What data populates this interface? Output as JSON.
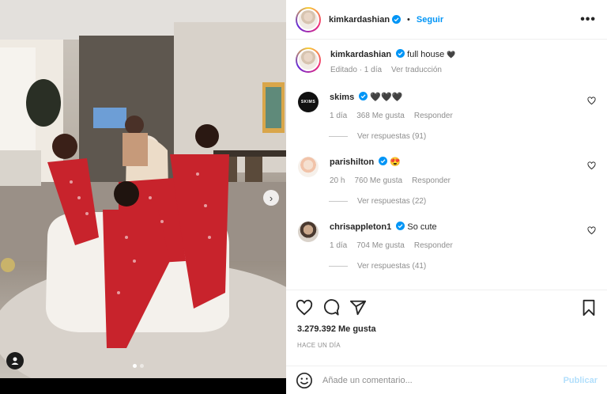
{
  "post": {
    "author": "kimkardashian",
    "follow_label": "Seguir",
    "separator": "•",
    "more_label": "•••",
    "caption_text": "full house",
    "caption_emoji": "🖤",
    "edited_label": "Editado · 1 día",
    "translate_label": "Ver traducción",
    "likes": "3.279.392 Me gusta",
    "timestamp": "HACE UN DÍA"
  },
  "comments": [
    {
      "user": "skims",
      "text": "🖤🖤🖤",
      "age": "1 día",
      "likes": "368 Me gusta",
      "reply_label": "Responder",
      "replies": "Ver respuestas (91)"
    },
    {
      "user": "parishilton",
      "text": "😍",
      "age": "20 h",
      "likes": "760 Me gusta",
      "reply_label": "Responder",
      "replies": "Ver respuestas (22)"
    },
    {
      "user": "chrisappleton1",
      "text": "So cute",
      "age": "1 día",
      "likes": "704 Me gusta",
      "reply_label": "Responder",
      "replies": "Ver respuestas (41)"
    }
  ],
  "composer": {
    "placeholder": "Añade un comentario...",
    "publish_label": "Publicar"
  },
  "skims_avatar_text": "SKIMS",
  "colors": {
    "accent": "#0095f6",
    "publish_disabled": "#b2dffc",
    "secondary_text": "#8e8e8e",
    "pajama_red": "#c8232c"
  },
  "icons": [
    "verified-icon",
    "more-icon",
    "heart-icon",
    "comment-icon",
    "share-icon",
    "bookmark-icon",
    "emoji-icon",
    "user-tag-icon",
    "chevron-right-icon"
  ]
}
